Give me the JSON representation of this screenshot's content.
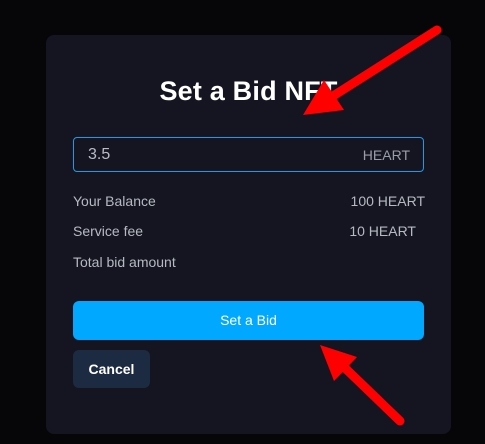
{
  "modal": {
    "title": "Set a Bid NFT",
    "bid_input": {
      "value": "3.5",
      "unit": "HEART"
    },
    "rows": [
      {
        "label": "Your Balance",
        "value": "100 HEART"
      },
      {
        "label": "Service fee",
        "value": "10 HEART"
      },
      {
        "label": "Total bid amount",
        "value": ""
      }
    ],
    "primary_button": "Set a Bid",
    "cancel_button": "Cancel"
  },
  "colors": {
    "accent": "#00a8ff",
    "annotation_arrow": "#ff0000",
    "modal_bg": "#141520",
    "cancel_bg": "#1d2b42"
  },
  "icons": [
    "red-arrow-annotation-icon",
    "red-arrow-annotation-icon"
  ]
}
